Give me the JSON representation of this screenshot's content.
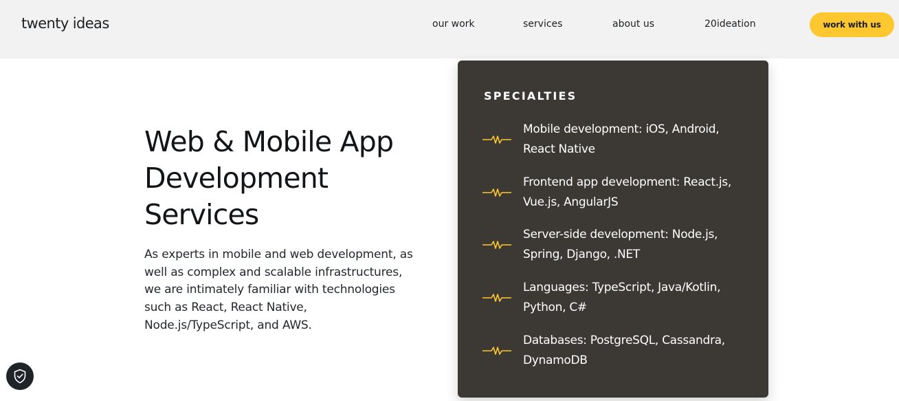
{
  "header": {
    "logo": "twenty ideas",
    "nav": [
      "our work",
      "services",
      "about us",
      "20ideation"
    ],
    "cta_label": "work with us",
    "accent": "#fdc72f"
  },
  "hero": {
    "title": "Web & Mobile App Development Services",
    "description": "As experts in mobile and web development, as well as complex and scalable infrastructures, we are intimately familiar with technologies such as React, React Native, Node.js/TypeScript, and AWS."
  },
  "specialties": {
    "heading": "SPECIALTIES",
    "icon": "pulse-wave-icon",
    "items": [
      "Mobile development: iOS, Android, React Native",
      "Frontend app development: React.js, Vue.js, AngularJS",
      "Server-side development: Node.js, Spring, Django, .NET",
      "Languages: TypeScript, Java/Kotlin, Python, C#",
      "Databases: PostgreSQL, Cassandra, DynamoDB"
    ]
  },
  "privacy_badge": {
    "icon": "shield-check-icon"
  }
}
